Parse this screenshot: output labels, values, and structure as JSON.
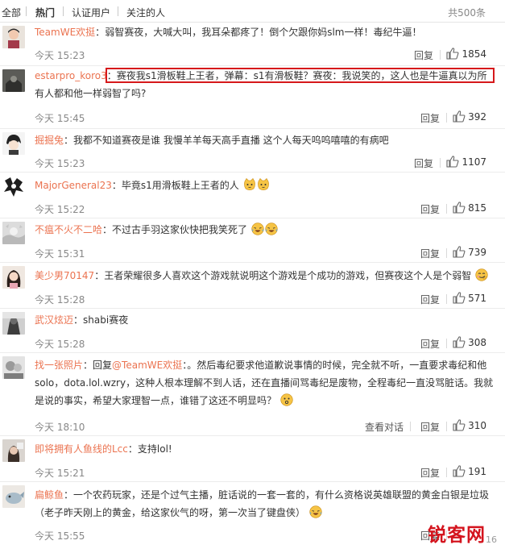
{
  "tabs": {
    "items": [
      "全部",
      "热门",
      "认证用户",
      "关注的人"
    ],
    "active_index": 1,
    "total": "共500条"
  },
  "actions": {
    "reply": "回复",
    "view_conversation": "查看对话"
  },
  "colors": {
    "username": "#eb7350",
    "highlight_border": "#d6191b",
    "watermark": "#d4141e"
  },
  "comments": [
    {
      "user": "TeamWE欢挺",
      "separator": "：",
      "content": "弱智赛夜，大喊大叫，我耳朵都疼了！倒个欠跟你妈slm一样！毒纪牛逼！",
      "time": "今天 15:23",
      "likes": "1854",
      "avatar_icon": "avatar-icon"
    },
    {
      "user": "estarpro_koro3",
      "separator": "：",
      "content": "赛夜我s1滑板鞋上王者，弹幕：s1有滑板鞋？赛夜：我说笑的，这人也是牛逼真以为所有人都和他一样弱智了吗?",
      "time": "今天 15:45",
      "likes": "392",
      "avatar_icon": "avatar-icon",
      "highlighted": true
    },
    {
      "user": "掘掘兔",
      "separator": "：",
      "content": "我都不知道赛夜是谁 我慢羊羊每天高手直播 这个人每天呜呜嘻嘻的有病吧",
      "time": "今天 15:23",
      "likes": "1107",
      "avatar_icon": "avatar-icon"
    },
    {
      "user": "MajorGeneral23",
      "separator": "：",
      "content": "毕竟s1用滑板鞋上王者的人",
      "time": "今天 15:22",
      "likes": "815",
      "emojis": [
        "cat-face-emoji",
        "cat-face-emoji"
      ],
      "avatar_icon": "avatar-icon"
    },
    {
      "user": "不瘟不火不二哈",
      "separator": "：",
      "content": "不过古手羽这家伙快把我笑死了",
      "time": "今天 15:31",
      "likes": "739",
      "emojis": [
        "laughing-tears-emoji",
        "laughing-tears-emoji"
      ],
      "avatar_icon": "avatar-icon"
    },
    {
      "user": "美少男70147",
      "separator": "：",
      "content": "王者荣耀很多人喜欢这个游戏就说明这个游戏是个成功的游戏，但赛夜这个人是个弱智",
      "time": "今天 15:28",
      "likes": "571",
      "emojis": [
        "smirk-emoji"
      ],
      "avatar_icon": "avatar-icon"
    },
    {
      "user": "武汉炫迈",
      "separator": "：",
      "content": "shabi赛夜",
      "time": "今天 15:28",
      "likes": "308",
      "avatar_icon": "avatar-icon"
    },
    {
      "user": "找一张照片",
      "separator": "：",
      "reply_prefix": "回复",
      "reply_to": "@TeamWE欢挺",
      "content": "：。然后毒纪要求他道歉说事情的时候，完全就不听，一直要求毒纪和他solo，dota.lol.wzry，这种人根本理解不到人话，还在直播间骂毒纪是废物，全程毒纪一直没骂脏话。我就是说的事实，希望大家理智一点，谁错了这还不明显吗？",
      "time": "今天 18:10",
      "likes": "310",
      "emojis": [
        "thinking-face-emoji"
      ],
      "view_conversation": true,
      "avatar_icon": "avatar-icon"
    },
    {
      "user": "即将拥有人鱼线的Lcc",
      "separator": "：",
      "content": "支持lol!",
      "time": "今天 15:21",
      "likes": "191",
      "avatar_icon": "avatar-icon"
    },
    {
      "user": "扁鲸鱼",
      "separator": "：",
      "content": "一个农药玩家，还是个过气主播，脏话说的一套一套的，有什么资格说英雄联盟的黄金白银是垃圾（老子昨天刚上的黄金，给这家伙气的呀，第一次当了键盘侠）",
      "time": "今天 15:55",
      "likes": "",
      "emojis": [
        "laughing-tears-emoji"
      ],
      "avatar_icon": "avatar-icon"
    }
  ],
  "watermark": {
    "text": "锐客网",
    "sub": "16"
  }
}
